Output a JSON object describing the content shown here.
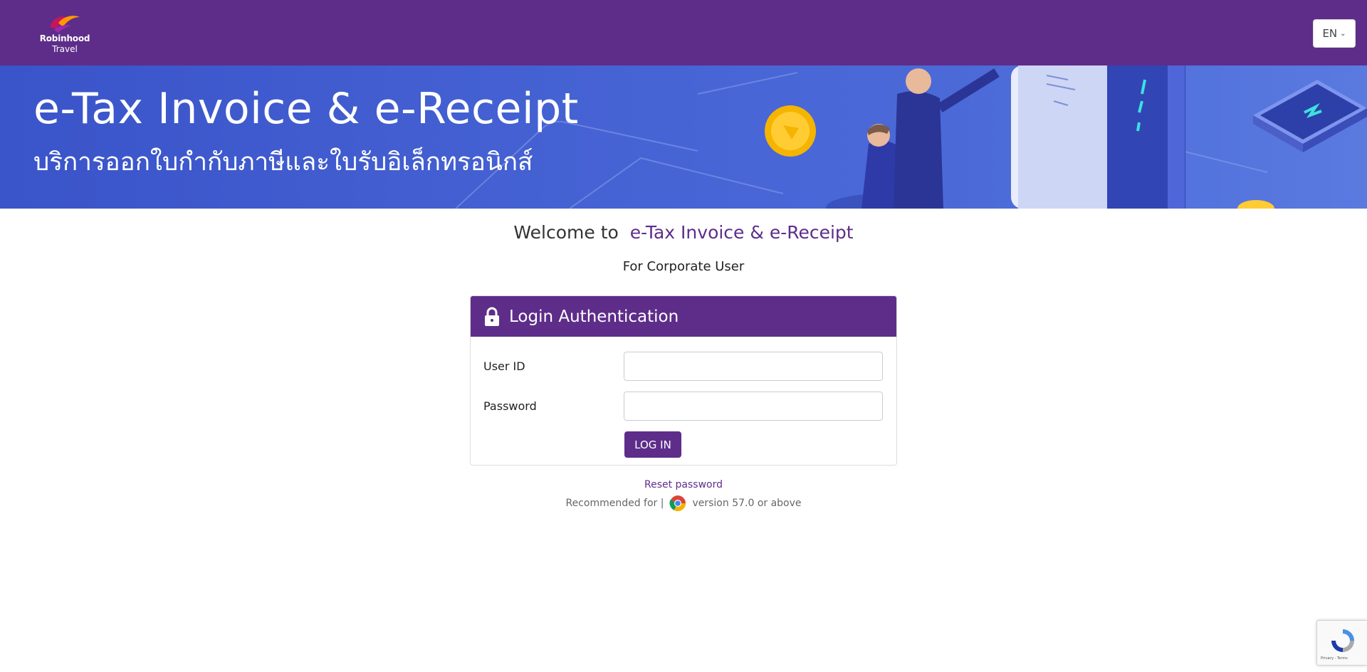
{
  "header": {
    "logo_name": "Robinhood",
    "logo_sub": "Travel",
    "language": "EN"
  },
  "banner": {
    "title": "e-Tax Invoice & e-Receipt",
    "subtitle": "บริการออกใบกำกับภาษีและใบรับอิเล็กทรอนิกส์"
  },
  "welcome": {
    "prefix": "Welcome to",
    "product": "e-Tax Invoice & e-Receipt",
    "audience": "For Corporate User"
  },
  "login": {
    "title": "Login Authentication",
    "user_id_label": "User ID",
    "user_id_value": "",
    "password_label": "Password",
    "password_value": "",
    "submit_label": "LOG IN"
  },
  "footer": {
    "reset_link": "Reset password",
    "recommended_prefix": "Recommended for |",
    "recommended_suffix": "version 57.0 or above"
  },
  "recaptcha": {
    "text": "Privacy - Terms"
  },
  "colors": {
    "brand_purple": "#5e2d8a",
    "banner_blue": "#4663d4"
  },
  "icons": [
    "logo-bird-icon",
    "chevron-down-icon",
    "lock-icon",
    "chrome-icon",
    "recaptcha-icon"
  ]
}
